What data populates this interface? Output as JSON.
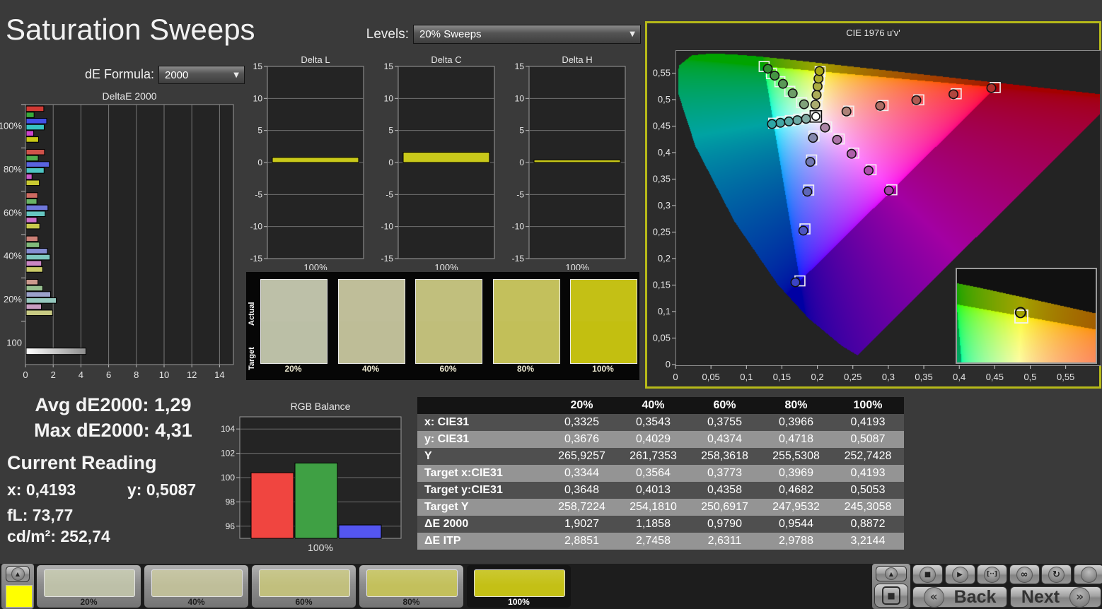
{
  "app": {
    "title": "Saturation Sweeps"
  },
  "toolbar": {
    "de_formula_label": "dE Formula:",
    "de_formula_value": "2000",
    "levels_label": "Levels:",
    "levels_value": "20% Sweeps"
  },
  "summary": {
    "avg_label": "Avg dE2000:",
    "avg_value": "1,29",
    "max_label": "Max dE2000:",
    "max_value": "4,31"
  },
  "current_reading": {
    "title": "Current Reading",
    "x_label": "x:",
    "x_value": "0,4193",
    "y_label": "y:",
    "y_value": "0,5087",
    "fl_label": "fL:",
    "fl_value": "73,77",
    "cd_label": "cd/m²:",
    "cd_value": "252,74"
  },
  "colors": {
    "accent_border": "#b6b919",
    "channel_full": {
      "red": "#d03a34",
      "green": "#3aa83a",
      "blue": "#4450e8",
      "cyan": "#36c3c3",
      "magenta": "#cc44cc",
      "yellow": "#c9c916"
    },
    "bar_mix_base": "#c8cbbc",
    "delta_bar": "#c9c91a",
    "rgb_bars": {
      "red": "#f04540",
      "green": "#3fa044",
      "blue": "#5456f0"
    }
  },
  "chart_data": [
    {
      "id": "deltae2000",
      "type": "bar",
      "orientation": "horizontal",
      "title": "DeltaE 2000",
      "xlim": [
        0,
        15
      ],
      "xticks": [
        0,
        2,
        4,
        6,
        8,
        10,
        12,
        14
      ],
      "series_order": [
        "red",
        "green",
        "blue",
        "cyan",
        "magenta",
        "yellow"
      ],
      "groups": [
        {
          "label": "100%",
          "sat": 1.0,
          "values": [
            1.27,
            0.57,
            1.48,
            1.3,
            0.54,
            0.89
          ]
        },
        {
          "label": "80%",
          "sat": 0.8,
          "values": [
            1.32,
            0.87,
            1.67,
            1.29,
            0.42,
            0.95
          ]
        },
        {
          "label": "60%",
          "sat": 0.6,
          "values": [
            0.83,
            0.77,
            1.57,
            1.37,
            0.77,
            0.98
          ]
        },
        {
          "label": "40%",
          "sat": 0.4,
          "values": [
            0.85,
            0.96,
            1.53,
            1.72,
            1.11,
            1.19
          ]
        },
        {
          "label": "20%",
          "sat": 0.2,
          "values": [
            0.85,
            1.2,
            1.76,
            2.17,
            1.1,
            1.9
          ]
        },
        {
          "label": "100",
          "sat": 0.0,
          "white": true,
          "values": [
            4.31
          ]
        }
      ]
    },
    {
      "id": "delta_l",
      "type": "bar",
      "title": "Delta L",
      "categories": [
        "100%"
      ],
      "values": [
        0.8
      ],
      "ylim": [
        -15,
        15
      ],
      "yticks": [
        15,
        10,
        5,
        0,
        -5,
        -10,
        -15
      ]
    },
    {
      "id": "delta_c",
      "type": "bar",
      "title": "Delta C",
      "categories": [
        "100%"
      ],
      "values": [
        1.6
      ],
      "ylim": [
        -15,
        15
      ],
      "yticks": [
        15,
        10,
        5,
        0,
        -5,
        -10,
        -15
      ]
    },
    {
      "id": "delta_h",
      "type": "bar",
      "title": "Delta H",
      "categories": [
        "100%"
      ],
      "values": [
        0.4
      ],
      "ylim": [
        -15,
        15
      ],
      "yticks": [
        15,
        10,
        5,
        0,
        -5,
        -10,
        -15
      ]
    },
    {
      "id": "rgb_balance",
      "type": "bar",
      "title": "RGB Balance",
      "categories": [
        "100%"
      ],
      "series": [
        {
          "name": "red",
          "values": [
            100.4
          ]
        },
        {
          "name": "green",
          "values": [
            101.2
          ]
        },
        {
          "name": "blue",
          "values": [
            96.1
          ]
        }
      ],
      "ylim": [
        95,
        105
      ],
      "yticks": [
        96,
        98,
        100,
        102,
        104
      ]
    },
    {
      "id": "cie",
      "type": "scatter",
      "title": "CIE 1976 u'v'",
      "axis_tick_labels": [
        "0",
        "0,05",
        "0,1",
        "0,15",
        "0,2",
        "0,25",
        "0,3",
        "0,35",
        "0,4",
        "0,45",
        "0,5",
        "0,55"
      ],
      "tick_step": 0.05,
      "white_point": [
        0.1978,
        0.4683
      ],
      "saturations": [
        0.2,
        0.4,
        0.6,
        0.8,
        1.0
      ],
      "channels": [
        {
          "name": "red",
          "targets": [
            [
              0.2442,
              0.4783
            ],
            [
              0.2926,
              0.4888
            ],
            [
              0.343,
              0.4996
            ],
            [
              0.3957,
              0.511
            ],
            [
              0.4507,
              0.5229
            ]
          ],
          "measured": [
            [
              0.241,
              0.4776
            ],
            [
              0.2885,
              0.4882
            ],
            [
              0.3395,
              0.499
            ],
            [
              0.3918,
              0.5102
            ],
            [
              0.4452,
              0.5219
            ]
          ]
        },
        {
          "name": "green",
          "targets": [
            [
              0.1778,
              0.4942
            ],
            [
              0.1612,
              0.5157
            ],
            [
              0.1472,
              0.5338
            ],
            [
              0.1353,
              0.5492
            ],
            [
              0.125,
              0.5625
            ]
          ],
          "measured": [
            [
              0.1812,
              0.4912
            ],
            [
              0.1652,
              0.5118
            ],
            [
              0.1515,
              0.5298
            ],
            [
              0.1398,
              0.5452
            ],
            [
              0.1302,
              0.5582
            ]
          ]
        },
        {
          "name": "blue",
          "targets": [
            [
              0.1952,
              0.4313
            ],
            [
              0.1919,
              0.3861
            ],
            [
              0.1878,
              0.3293
            ],
            [
              0.1825,
              0.256
            ],
            [
              0.1754,
              0.1579
            ]
          ],
          "measured": [
            [
              0.1938,
              0.4278
            ],
            [
              0.19,
              0.3825
            ],
            [
              0.1858,
              0.3262
            ],
            [
              0.1802,
              0.2528
            ],
            [
              0.169,
              0.1552
            ]
          ]
        },
        {
          "name": "cyan",
          "targets": [
            [
              0.1857,
              0.4657
            ],
            [
              0.1737,
              0.4631
            ],
            [
              0.1618,
              0.4605
            ],
            [
              0.15,
              0.458
            ],
            [
              0.1384,
              0.4555
            ]
          ],
          "measured": [
            [
              0.184,
              0.4638
            ],
            [
              0.1718,
              0.4612
            ],
            [
              0.1598,
              0.4588
            ],
            [
              0.1478,
              0.4563
            ],
            [
              0.136,
              0.454
            ]
          ]
        },
        {
          "name": "magenta",
          "targets": [
            [
              0.2131,
              0.4486
            ],
            [
              0.2308,
              0.4257
            ],
            [
              0.2514,
              0.3991
            ],
            [
              0.2757,
              0.3676
            ],
            [
              0.305,
              0.3298
            ]
          ],
          "measured": [
            [
              0.2108,
              0.4472
            ],
            [
              0.2278,
              0.4242
            ],
            [
              0.2482,
              0.3978
            ],
            [
              0.2722,
              0.3662
            ],
            [
              0.3008,
              0.3285
            ]
          ]
        },
        {
          "name": "yellow",
          "targets": [
            [
              0.1994,
              0.4894
            ],
            [
              0.2007,
              0.5085
            ],
            [
              0.2019,
              0.5247
            ],
            [
              0.2029,
              0.5385
            ],
            [
              0.2039,
              0.5529
            ]
          ],
          "measured": [
            [
              0.1971,
              0.4904
            ],
            [
              0.1989,
              0.5089
            ],
            [
              0.2003,
              0.525
            ],
            [
              0.2016,
              0.5396
            ],
            [
              0.2029,
              0.5539
            ]
          ]
        }
      ],
      "locus": [
        [
          0.2568,
          0.0172
        ],
        [
          0.2347,
          0.035
        ],
        [
          0.1877,
          0.0871
        ],
        [
          0.1441,
          0.151
        ],
        [
          0.0828,
          0.2708
        ],
        [
          0.0282,
          0.4117
        ],
        [
          0.0035,
          0.5131
        ],
        [
          0.0046,
          0.5639
        ],
        [
          0.0231,
          0.5837
        ],
        [
          0.0501,
          0.5868
        ],
        [
          0.0792,
          0.5856
        ],
        [
          0.1127,
          0.5821
        ],
        [
          0.1531,
          0.5766
        ],
        [
          0.2026,
          0.5693
        ],
        [
          0.2623,
          0.5604
        ],
        [
          0.3315,
          0.5501
        ],
        [
          0.4035,
          0.5393
        ],
        [
          0.4692,
          0.5296
        ],
        [
          0.5202,
          0.5219
        ],
        [
          0.5565,
          0.5165
        ],
        [
          0.583,
          0.5125
        ],
        [
          0.6005,
          0.5099
        ],
        [
          0.6234,
          0.5065
        ]
      ],
      "inset": {
        "u0": 0.125,
        "u1": 0.295,
        "v0": 0.515,
        "v1": 0.592,
        "target": [
          0.2039,
          0.5529
        ],
        "measured": [
          0.2029,
          0.5539
        ]
      }
    },
    {
      "id": "sweep_table",
      "type": "table",
      "columns": [
        "",
        "20%",
        "40%",
        "60%",
        "80%",
        "100%"
      ],
      "rows": [
        {
          "label": "x: CIE31",
          "values": [
            "0,3325",
            "0,3543",
            "0,3755",
            "0,3966",
            "0,4193"
          ]
        },
        {
          "label": "y: CIE31",
          "values": [
            "0,3676",
            "0,4029",
            "0,4374",
            "0,4718",
            "0,5087"
          ]
        },
        {
          "label": "Y",
          "values": [
            "265,9257",
            "261,7353",
            "258,3618",
            "255,5308",
            "252,7428"
          ]
        },
        {
          "label": "Target x:CIE31",
          "values": [
            "0,3344",
            "0,3564",
            "0,3773",
            "0,3969",
            "0,4193"
          ]
        },
        {
          "label": "Target y:CIE31",
          "values": [
            "0,3648",
            "0,4013",
            "0,4358",
            "0,4682",
            "0,5053"
          ]
        },
        {
          "label": "Target Y",
          "values": [
            "258,7224",
            "254,1810",
            "250,6917",
            "247,9532",
            "245,3058"
          ]
        },
        {
          "label": "ΔE 2000",
          "values": [
            "1,9027",
            "1,1858",
            "0,9790",
            "0,9544",
            "0,8872"
          ]
        },
        {
          "label": "ΔE ITP",
          "values": [
            "2,8851",
            "2,7458",
            "2,6311",
            "2,9788",
            "3,2144"
          ]
        }
      ]
    }
  ],
  "swatch_strip": {
    "actual_label": "Actual",
    "target_label": "Target",
    "items": [
      {
        "label": "20%",
        "actual": "#bdc0a8",
        "target": "#bbbfa6"
      },
      {
        "label": "40%",
        "actual": "#bfbe99",
        "target": "#bebd97"
      },
      {
        "label": "60%",
        "actual": "#c1bf7d",
        "target": "#c0be7a"
      },
      {
        "label": "80%",
        "actual": "#c3c05c",
        "target": "#c2bf59"
      },
      {
        "label": "100%",
        "actual": "#c4c015",
        "target": "#c3bf10"
      }
    ]
  },
  "bottom_bar": {
    "patch_color": "#ffff00",
    "tiles": [
      {
        "label": "20%",
        "color": "#bdc0a8",
        "selected": false
      },
      {
        "label": "40%",
        "color": "#bfbe99",
        "selected": false
      },
      {
        "label": "60%",
        "color": "#c1bf7d",
        "selected": false
      },
      {
        "label": "80%",
        "color": "#c3c05c",
        "selected": false
      },
      {
        "label": "100%",
        "color": "#c4c015",
        "selected": true
      }
    ],
    "back_label": "Back",
    "next_label": "Next",
    "transport_icons": [
      "stop",
      "play",
      "interval",
      "infinity",
      "refresh",
      "blank"
    ],
    "transport_glyphs": {
      "stop": "■",
      "play": "▶",
      "interval": "[··]",
      "infinity": "∞",
      "refresh": "↻",
      "blank": ""
    }
  }
}
